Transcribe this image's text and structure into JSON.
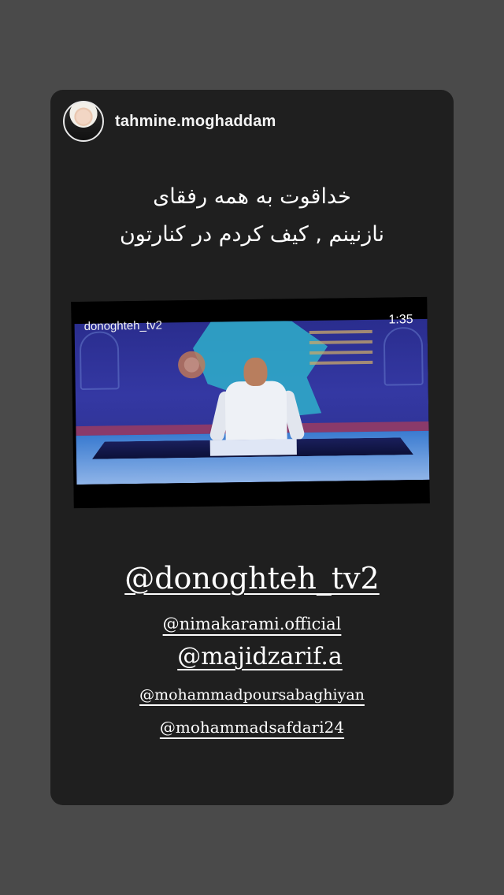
{
  "story": {
    "username": "tahmine.moghaddam",
    "caption_line1": "خداقوت به همه رفقای",
    "caption_line2": "نازنینم , کیف کردم در کنارتون"
  },
  "video": {
    "channel": "donoghteh_tv2",
    "duration": "1:35"
  },
  "mentions": [
    "@donoghteh_tv2",
    "@nimakarami.official",
    "@majidzarif.a",
    "@mohammadpoursabaghiyan",
    "@mohammadsafdari24"
  ]
}
